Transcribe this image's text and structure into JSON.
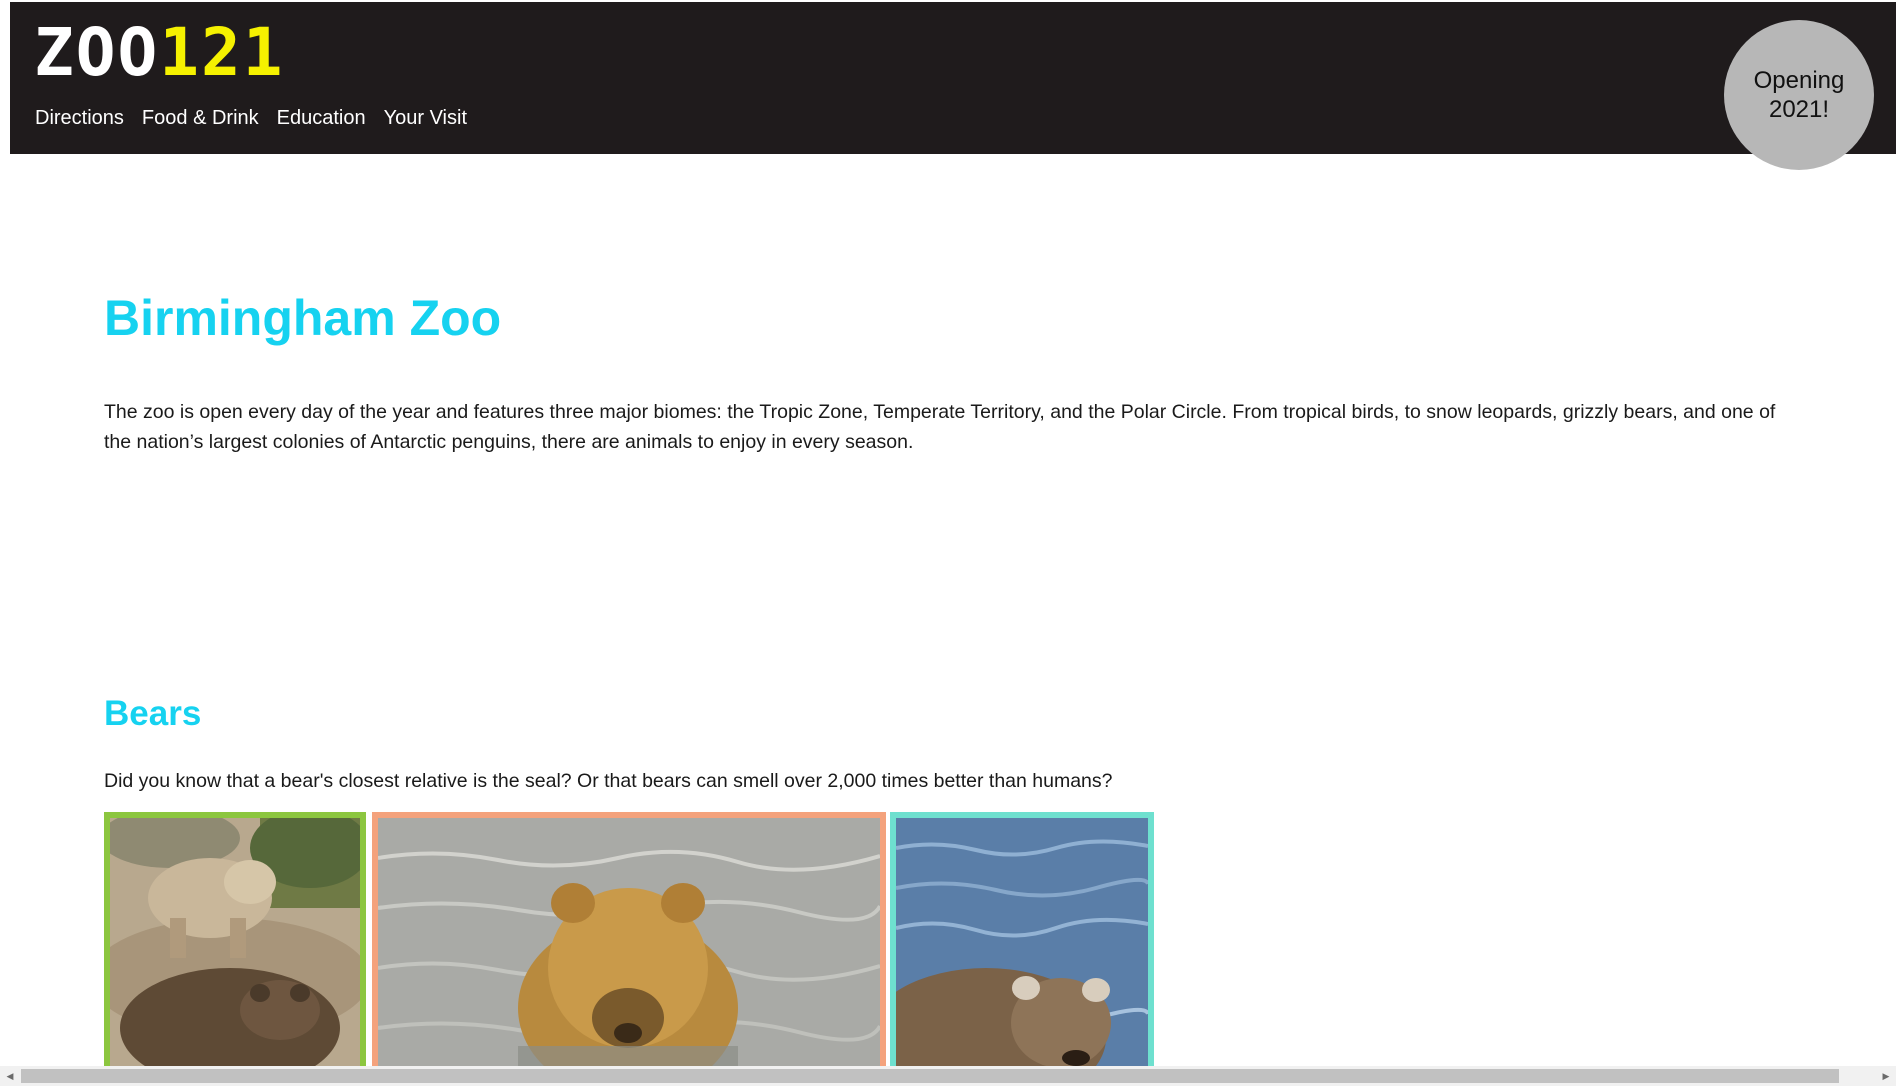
{
  "header": {
    "logo_white": "ZOO",
    "logo_yellow": "121",
    "nav": [
      "Directions",
      "Food & Drink",
      "Education",
      "Your Visit"
    ],
    "badge_line1": "Opening",
    "badge_line2": "2021!"
  },
  "main": {
    "title": "Birmingham Zoo",
    "intro": "The zoo is open every day of the year and features three major biomes: the Tropic Zone, Temperate Territory, and the Polar Circle. From tropical birds, to snow leopards, grizzly bears, and one of the nation’s largest colonies of Antarctic penguins, there are animals to enjoy in every season.",
    "section_title": "Bears",
    "section_text": "Did you know that a bear's closest relative is the seal? Or that bears can smell over 2,000 times better than humans?"
  },
  "colors": {
    "header_bg": "#1f1b1c",
    "logo_accent": "#f5f100",
    "heading": "#16d2f0",
    "badge_bg": "#b7b7b7",
    "photo1_border": "#8cc63f",
    "photo2_border": "#f4a27c",
    "photo3_border": "#6ee0cf"
  },
  "icons": {
    "scroll_left": "scroll-left-arrow-icon",
    "scroll_right": "scroll-right-arrow-icon"
  }
}
